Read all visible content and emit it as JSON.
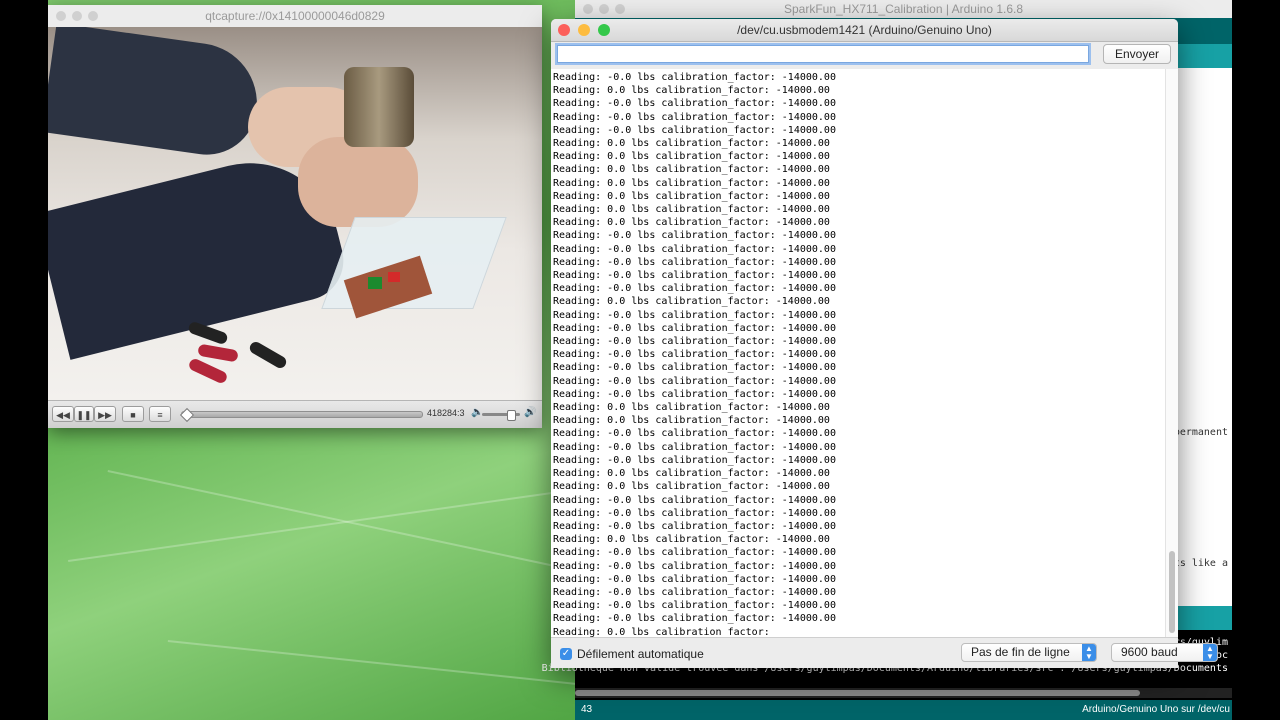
{
  "ide": {
    "title": "SparkFun_HX711_Calibration | Arduino 1.6.8",
    "editor_fragments": [
      "permanent",
      "its like a"
    ],
    "console_lines": [
      "Users/guylim",
      "impas/Doc",
      "Bibliothèque non valide trouvée dans /Users/guylimpas/Documents/Arduino/libraries/src : /Users/guylimpas/Documents"
    ],
    "status_line": "43",
    "status_board": "Arduino/Genuino Uno sur /dev/cu"
  },
  "quicktime": {
    "title": "qtcapture://0x14100000046d0829",
    "time": "418284:3",
    "controls": {
      "rewind": "◀◀",
      "pause": "❚❚",
      "forward": "▶▶",
      "stop": "■",
      "menu": "≡"
    },
    "progress": 0
  },
  "serial_monitor": {
    "title": "/dev/cu.usbmodem1421 (Arduino/Genuino Uno)",
    "input_value": "",
    "send_label": "Envoyer",
    "autoscroll_label": "Défilement automatique",
    "autoscroll_checked": true,
    "line_ending": "Pas de fin de ligne",
    "baud": "9600 baud",
    "lines": [
      "Reading: -0.0 lbs calibration_factor: -14000.00",
      "Reading: 0.0 lbs calibration_factor: -14000.00",
      "Reading: -0.0 lbs calibration_factor: -14000.00",
      "Reading: -0.0 lbs calibration_factor: -14000.00",
      "Reading: -0.0 lbs calibration_factor: -14000.00",
      "Reading: 0.0 lbs calibration_factor: -14000.00",
      "Reading: 0.0 lbs calibration_factor: -14000.00",
      "Reading: 0.0 lbs calibration_factor: -14000.00",
      "Reading: 0.0 lbs calibration_factor: -14000.00",
      "Reading: 0.0 lbs calibration_factor: -14000.00",
      "Reading: 0.0 lbs calibration_factor: -14000.00",
      "Reading: 0.0 lbs calibration_factor: -14000.00",
      "Reading: -0.0 lbs calibration_factor: -14000.00",
      "Reading: -0.0 lbs calibration_factor: -14000.00",
      "Reading: -0.0 lbs calibration_factor: -14000.00",
      "Reading: -0.0 lbs calibration_factor: -14000.00",
      "Reading: -0.0 lbs calibration_factor: -14000.00",
      "Reading: 0.0 lbs calibration_factor: -14000.00",
      "Reading: -0.0 lbs calibration_factor: -14000.00",
      "Reading: -0.0 lbs calibration_factor: -14000.00",
      "Reading: -0.0 lbs calibration_factor: -14000.00",
      "Reading: -0.0 lbs calibration_factor: -14000.00",
      "Reading: -0.0 lbs calibration_factor: -14000.00",
      "Reading: -0.0 lbs calibration_factor: -14000.00",
      "Reading: -0.0 lbs calibration_factor: -14000.00",
      "Reading: 0.0 lbs calibration_factor: -14000.00",
      "Reading: 0.0 lbs calibration_factor: -14000.00",
      "Reading: -0.0 lbs calibration_factor: -14000.00",
      "Reading: -0.0 lbs calibration_factor: -14000.00",
      "Reading: -0.0 lbs calibration_factor: -14000.00",
      "Reading: 0.0 lbs calibration_factor: -14000.00",
      "Reading: 0.0 lbs calibration_factor: -14000.00",
      "Reading: -0.0 lbs calibration_factor: -14000.00",
      "Reading: -0.0 lbs calibration_factor: -14000.00",
      "Reading: -0.0 lbs calibration_factor: -14000.00",
      "Reading: 0.0 lbs calibration_factor: -14000.00",
      "Reading: -0.0 lbs calibration_factor: -14000.00",
      "Reading: -0.0 lbs calibration_factor: -14000.00",
      "Reading: -0.0 lbs calibration_factor: -14000.00",
      "Reading: -0.0 lbs calibration_factor: -14000.00",
      "Reading: -0.0 lbs calibration_factor: -14000.00",
      "Reading: -0.0 lbs calibration_factor: -14000.00",
      "Reading: 0.0 lbs calibration_factor:"
    ]
  },
  "colors": {
    "arduino_teal": "#006468",
    "arduino_tab": "#17a1a5",
    "mac_blue": "#3b8ee8",
    "close": "#fc605b",
    "minimize": "#fdbc40",
    "zoom": "#34c84a"
  },
  "icons": {
    "close": "close-icon",
    "minimize": "minimize-icon",
    "zoom": "zoom-icon",
    "checkbox": "checkmark-icon",
    "select_arrows": "updown-arrows-icon",
    "volume_low": "speaker-low-icon",
    "volume_high": "speaker-high-icon"
  }
}
